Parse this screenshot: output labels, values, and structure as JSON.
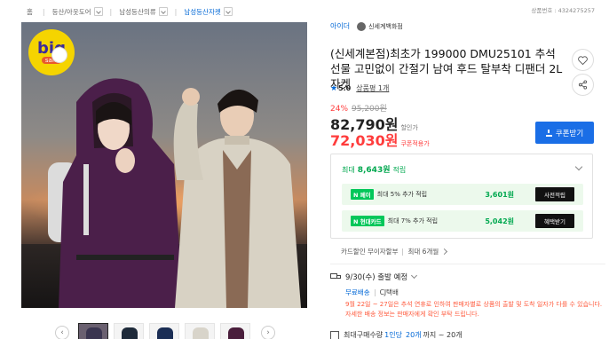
{
  "breadcrumb": {
    "home_icon": "home-icon",
    "items": [
      {
        "label": "홈",
        "active": false
      },
      {
        "label": "등산/아웃도어",
        "active": false
      },
      {
        "label": "남성등산의류",
        "active": false
      },
      {
        "label": "남성등산자켓",
        "active": true
      }
    ],
    "product_code": "상품번호 : 4324275257"
  },
  "image": {
    "badge_big": "big",
    "badge_sale": "sale"
  },
  "thumbnails": {
    "prev_icon": "chevron-left-icon",
    "next_icon": "chevron-right-icon",
    "items": [
      {
        "color": "#3a3550",
        "active": true
      },
      {
        "color": "#1e2a3a",
        "active": false
      },
      {
        "color": "#1b2e55",
        "active": false
      },
      {
        "color": "#d8d4ca",
        "active": false
      },
      {
        "color": "#4a1e3c",
        "active": false
      }
    ]
  },
  "seller": {
    "link": "아이더",
    "name": "신세계백화점"
  },
  "product": {
    "title": "(신세계본점)최초가 199000 DMU25101 추석선물 고민없이 간절기 남여 후드 탈부착 디팬더 2L 자켓",
    "rating": "5.0",
    "reviews": "상품평 1개"
  },
  "price": {
    "discount_rate": "24%",
    "original": "95,200원",
    "sale": "82,790원",
    "sale_label": "할인가",
    "coupon_price": "72,030원",
    "coupon_label": "쿠폰적용가",
    "coupon_button": "쿠폰받기"
  },
  "benefits": {
    "prefix": "최대",
    "points": "8,643원",
    "suffix": "적립",
    "cards": [
      {
        "brand": "N 페이",
        "brand_color": "#03c75a",
        "desc": "최대 5% 추가 적립",
        "amount": "3,601원",
        "button": "사전적립"
      },
      {
        "brand": "N 현대카드",
        "brand_color": "#03c75a",
        "desc": "최대 7% 추가 적립",
        "amount": "5,042원",
        "button": "혜택받기"
      }
    ]
  },
  "installment": {
    "label": "카드할인 무이자할부",
    "detail": "최대 6개월"
  },
  "shipping": {
    "head": "9/30(수) 출발 예정",
    "free": "무료배송",
    "courier": "CJ택배",
    "note": "9월 22일 ~ 27일은 추석 연휴로 인하여 판매자별로 상품의 출발 및 도착 일자가 다를 수 있습니다. 자세한 배송 정보는 판매자에게 확인 부탁 드립니다.",
    "next_prefix": "최대구매수량",
    "next_count": "1인당",
    "next_highlight": "20개",
    "next_suffix": "까지 ~ 20개"
  }
}
